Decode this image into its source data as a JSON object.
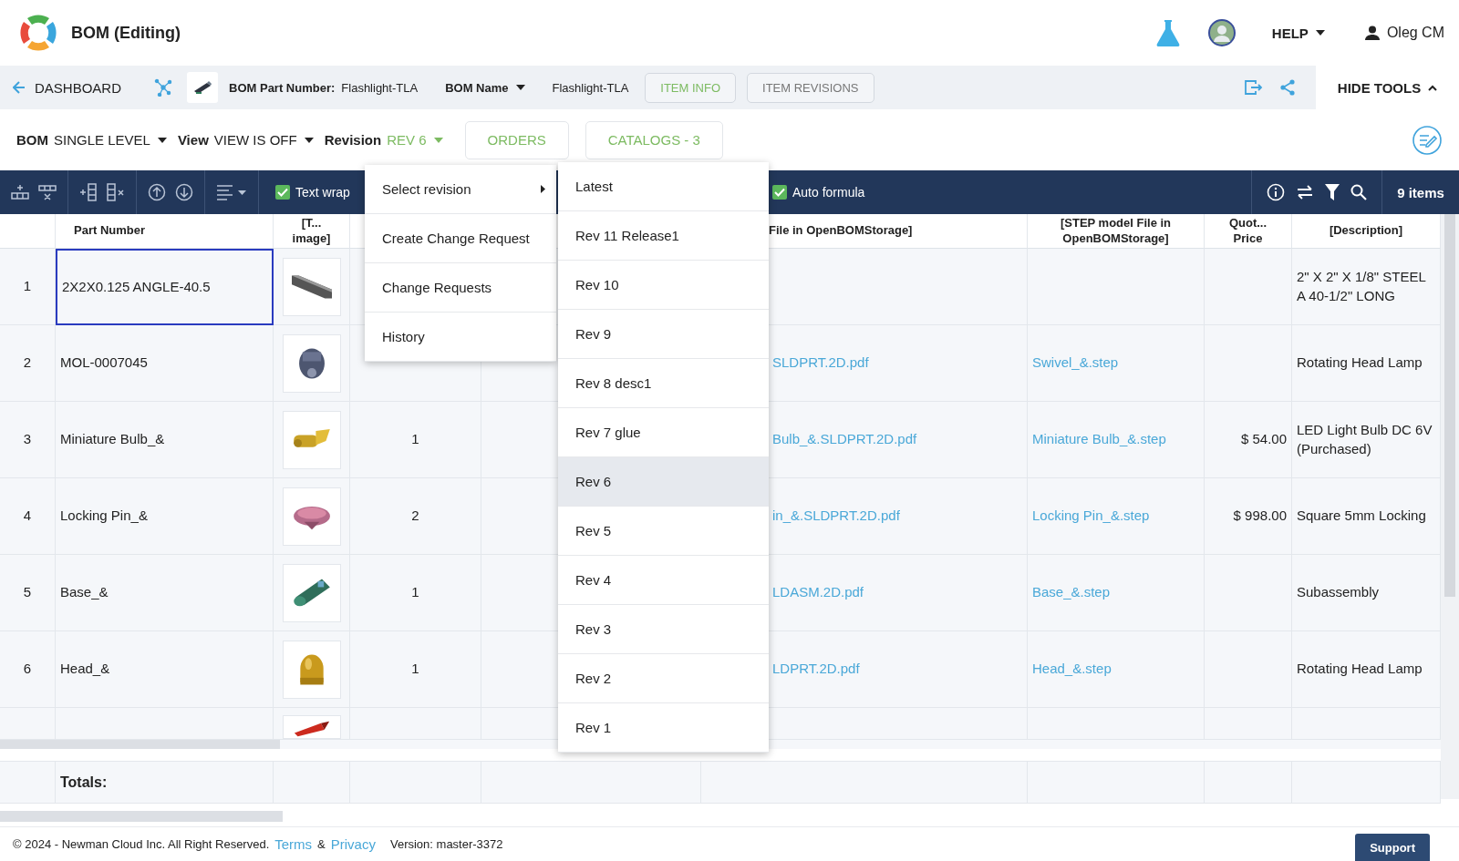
{
  "app": {
    "title": "BOM (Editing)"
  },
  "header": {
    "help": "HELP",
    "user": "Oleg CM"
  },
  "nav": {
    "back": "DASHBOARD",
    "part_number_label": "BOM Part Number:",
    "part_number": "Flashlight-TLA",
    "name_label": "BOM Name",
    "name": "Flashlight-TLA",
    "tabs": [
      {
        "label": "ITEM INFO",
        "selected": true
      },
      {
        "label": "ITEM REVISIONS",
        "selected": false
      }
    ],
    "hide_tools": "HIDE TOOLS"
  },
  "controls": {
    "bom_label": "BOM",
    "bom_value": "SINGLE LEVEL",
    "view_label": "View",
    "view_value": "VIEW IS OFF",
    "revision_label": "Revision",
    "revision_value": "REV 6",
    "buttons": [
      "ORDERS",
      "CATALOGS - 3"
    ]
  },
  "toolbar": {
    "options": [
      {
        "label": "Text wrap",
        "checked": true
      },
      {
        "label": "Auto formula",
        "checked": true
      }
    ],
    "count": "9 items"
  },
  "table": {
    "columns": [
      "Part Number",
      "[T... image]",
      "File in OpenBOMStorage]",
      "[STEP model File in OpenBOMStorage]",
      "Quot... Price",
      "[Description]"
    ],
    "rows": [
      {
        "num": "1",
        "part_number": "2X2X0.125 ANGLE-40.5",
        "selected": true,
        "description": "2\" X 2\" X 1/8\" STEEL A 40-1/2\" LONG"
      },
      {
        "num": "2",
        "part_number": "MOL-0007045",
        "selected": false,
        "file": "SLDPRT.2D.pdf",
        "step": "Swivel_&.step",
        "description": "Rotating Head Lamp"
      },
      {
        "num": "3",
        "part_number": "Miniature Bulb_&",
        "selected": false,
        "quantity": "1",
        "file": "Bulb_&.SLDPRT.2D.pdf",
        "step": "Miniature Bulb_&.step",
        "price": "$ 54.00",
        "description": "LED Light Bulb DC 6V (Purchased)"
      },
      {
        "num": "4",
        "part_number": "Locking Pin_&",
        "selected": false,
        "quantity": "2",
        "file": "in_&.SLDPRT.2D.pdf",
        "step": "Locking Pin_&.step",
        "price": "$ 998.00",
        "description": "Square 5mm Locking"
      },
      {
        "num": "5",
        "part_number": "Base_&",
        "selected": false,
        "quantity": "1",
        "file": "LDASM.2D.pdf",
        "step": "Base_&.step",
        "description": "Subassembly"
      },
      {
        "num": "6",
        "part_number": "Head_&",
        "selected": false,
        "quantity": "1",
        "file": "LDPRT.2D.pdf",
        "step": "Head_&.step",
        "description": "Rotating Head Lamp"
      }
    ],
    "totals_label": "Totals:"
  },
  "menu": {
    "items": [
      {
        "label": "Select revision",
        "kind": "submenu"
      },
      {
        "label": "Create Change Request",
        "kind": "action"
      },
      {
        "label": "Change Requests",
        "kind": "action"
      },
      {
        "label": "History",
        "kind": "action"
      }
    ],
    "revisions": [
      {
        "label": "Latest",
        "selected": false
      },
      {
        "label": "Rev 11 Release1",
        "selected": false
      },
      {
        "label": "Rev 10",
        "selected": false
      },
      {
        "label": "Rev 9",
        "selected": false
      },
      {
        "label": "Rev 8 desc1",
        "selected": false
      },
      {
        "label": "Rev 7 glue",
        "selected": false
      },
      {
        "label": "Rev 6",
        "selected": true
      },
      {
        "label": "Rev 5",
        "selected": false
      },
      {
        "label": "Rev 4",
        "selected": false
      },
      {
        "label": "Rev 3",
        "selected": false
      },
      {
        "label": "Rev 2",
        "selected": false
      },
      {
        "label": "Rev 1",
        "selected": false
      }
    ]
  },
  "footer": {
    "copyright": "© 2024 - Newman Cloud Inc. All Right Reserved.",
    "terms": "Terms",
    "amp": "&",
    "privacy": "Privacy",
    "version": "Version: master-3372",
    "support": "Support"
  }
}
